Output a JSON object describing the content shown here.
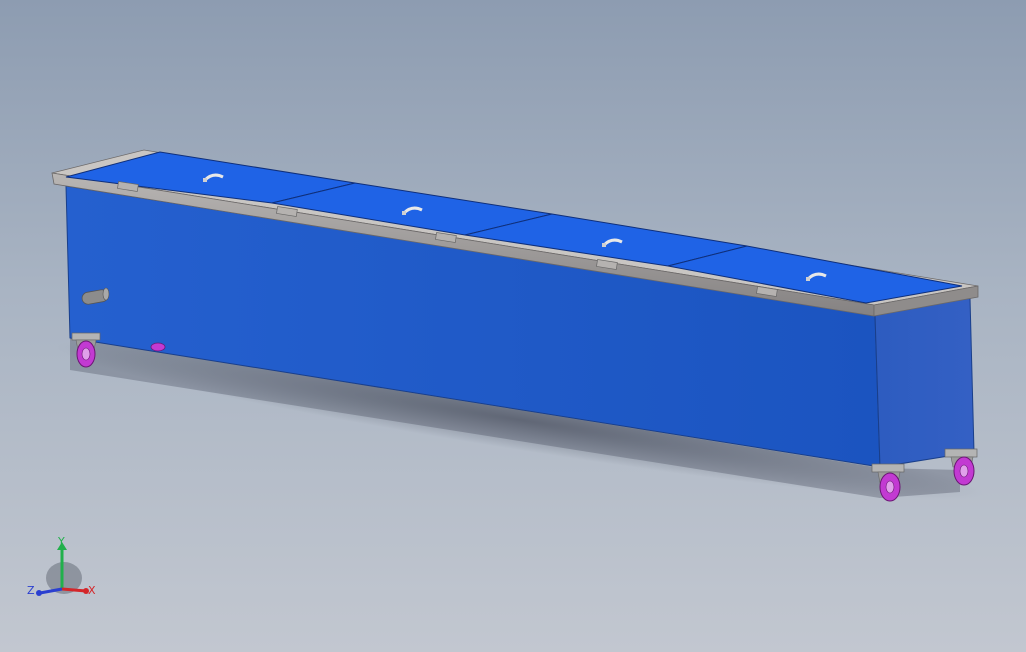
{
  "viewport": {
    "background_top": "#8d9cb1",
    "background_bottom": "#c2c7d0"
  },
  "model": {
    "body_color": "#1f5ac8",
    "lid_color": "#1e63e6",
    "rim_color": "#9b9898",
    "caster_wheel_color": "#c23ad2",
    "lid_count": 4,
    "caster_count": 4
  },
  "triad": {
    "x_label": "X",
    "y_label": "Y",
    "z_label": "Z",
    "x_color": "#d4262a",
    "y_color": "#21b04b",
    "z_color": "#2a3fd0",
    "x_icon": "x-axis-arrow-icon",
    "y_icon": "y-axis-arrow-icon",
    "z_icon": "z-axis-arrow-icon"
  }
}
